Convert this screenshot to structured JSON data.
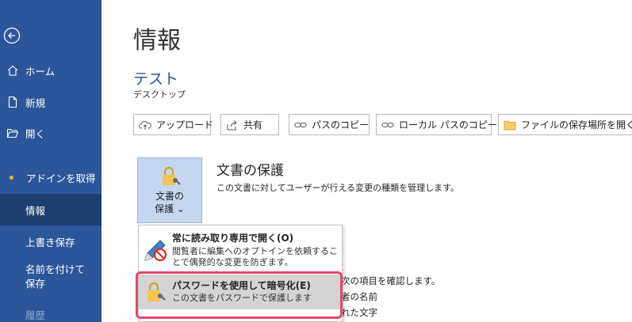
{
  "sidebar": {
    "back_label": "",
    "items": [
      {
        "label": "ホーム"
      },
      {
        "label": "新規"
      },
      {
        "label": "開く"
      },
      {
        "label": "アドインを取得"
      },
      {
        "label": "情報"
      },
      {
        "label": "上書き保存"
      },
      {
        "label": "名前を付けて保存"
      },
      {
        "label": "履歴"
      }
    ],
    "accent_color": "#2b579a",
    "selected_color": "#1d3f70"
  },
  "main": {
    "title": "情報",
    "document_name": "テスト",
    "document_location": "デスクトップ"
  },
  "toolbar": {
    "upload_label": "アップロード",
    "share_label": "共有",
    "copy_path_label": "パスのコピー",
    "copy_local_path_label": "ローカル パスのコピー",
    "open_location_label": "ファイルの保存場所を開く"
  },
  "protect": {
    "tile_line1": "文書の",
    "tile_line2": "保護 ⌄",
    "heading": "文書の保護",
    "description": "この文書に対してユーザーが行える変更の種類を管理します。"
  },
  "background_text": {
    "line1": "次の項目を確認します。",
    "line2": "者の名前",
    "line3": "れた文字"
  },
  "dropdown": {
    "items": [
      {
        "title": "常に読み取り専用で開く(O)",
        "description": "閲覧者に編集へのオプトインを依頼することで偶発的な変更を防ぎます。",
        "icon": "pencil-prohibit-icon"
      },
      {
        "title": "パスワードを使用して暗号化(E)",
        "description": "この文書をパスワードで保護します",
        "icon": "lock-key-icon",
        "highlighted": true
      }
    ],
    "highlight_color": "#e4476a"
  }
}
